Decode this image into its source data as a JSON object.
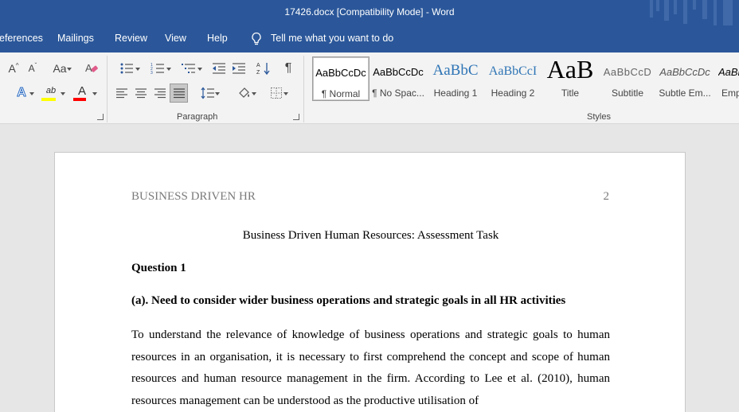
{
  "window": {
    "title": "17426.docx [Compatibility Mode]  -  Word"
  },
  "tabs": [
    {
      "label": "eferences"
    },
    {
      "label": "Mailings"
    },
    {
      "label": "Review"
    },
    {
      "label": "View"
    },
    {
      "label": "Help"
    }
  ],
  "tellme": {
    "label": "Tell me what you want to do",
    "icon": "lightbulb-icon"
  },
  "font_group": {
    "grow_label": "A",
    "shrink_label": "A",
    "case_label": "Aa",
    "text_effects_label": "A",
    "highlight_label": "ab",
    "font_color_label": "A",
    "highlight_color": "#ffff00",
    "font_color": "#ff0000"
  },
  "paragraph_group": {
    "label": "Paragraph",
    "pilcrow": "¶"
  },
  "styles_group": {
    "label": "Styles",
    "items": [
      {
        "preview": "AaBbCcDc",
        "name": "¶ Normal"
      },
      {
        "preview": "AaBbCcDc",
        "name": "¶ No Spac..."
      },
      {
        "preview": "AaBbC",
        "name": "Heading 1"
      },
      {
        "preview": "AaBbCcI",
        "name": "Heading 2"
      },
      {
        "preview": "AaB",
        "name": "Title"
      },
      {
        "preview": "AaBbCcD",
        "name": "Subtitle"
      },
      {
        "preview": "AaBbCcDc",
        "name": "Subtle Em..."
      },
      {
        "preview": "AaBl",
        "name": "Emp"
      }
    ]
  },
  "document": {
    "header_left": "BUSINESS DRIVEN HR",
    "header_right": "2",
    "title": "Business Driven Human Resources: Assessment Task",
    "question": "Question 1",
    "subheading": "(a). Need to consider wider business operations and strategic goals in all HR activities",
    "paragraph": "To understand the relevance of knowledge of business operations and strategic goals to human resources in an organisation, it is necessary to first comprehend the concept and scope of human resources and human resource management in the firm. According to Lee et al. (2010), human resources management can be understood as the productive utilisation of"
  },
  "colors": {
    "accent": "#2b579a",
    "ribbon": "#f3f3f3",
    "canvas": "#e6e6e6"
  }
}
